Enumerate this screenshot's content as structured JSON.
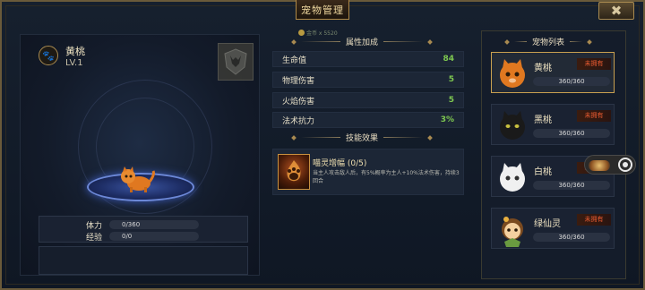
{
  "window": {
    "title": "宠物管理",
    "close_icon": "close-icon"
  },
  "currency": {
    "text": "金币 x 5520",
    "icon": "coin-icon"
  },
  "selected_pet": {
    "name": "黄桃",
    "level": "LV.1",
    "icon": "paw-icon",
    "shield_icon": "demon-shield-icon",
    "stats": [
      {
        "label": "体力",
        "value": "0/360"
      },
      {
        "label": "经验",
        "value": "0/0"
      }
    ]
  },
  "attributes": {
    "header": "属性加成",
    "rows": [
      {
        "name": "生命值",
        "value": "84"
      },
      {
        "name": "物理伤害",
        "value": "5"
      },
      {
        "name": "火焰伤害",
        "value": "5"
      },
      {
        "name": "法术抗力",
        "value": "3%"
      }
    ]
  },
  "skills": {
    "header": "技能效果",
    "items": [
      {
        "title": "喵灵增幅 (0/5)",
        "desc": "当主人攻击敌人后，有5%概率为主人+10%法术伤害，持续3回合",
        "icon": "flame-paw-icon"
      }
    ]
  },
  "pet_list": {
    "header": "宠物列表",
    "items": [
      {
        "name": "黄桃",
        "badge": "未拥有",
        "hp": "360/360",
        "avatar": "orange-cat-icon",
        "color": "#e07820",
        "selected": true
      },
      {
        "name": "黑桃",
        "badge": "未拥有",
        "hp": "360/360",
        "avatar": "black-cat-icon",
        "color": "#1a1a1a",
        "selected": false
      },
      {
        "name": "白桃",
        "badge": "未拥有",
        "hp": "360/360",
        "avatar": "white-cat-icon",
        "color": "#f0f0f0",
        "selected": false
      },
      {
        "name": "绿仙灵",
        "badge": "未拥有",
        "hp": "360/360",
        "avatar": "fairy-icon",
        "color": "#c88a40",
        "selected": false
      }
    ]
  },
  "floating": {
    "icon": "record-icon"
  },
  "colors": {
    "accent": "#c8a050",
    "value_green": "#7ec850",
    "badge_red": "#e85a30",
    "platform_blue": "#3a54a0"
  }
}
